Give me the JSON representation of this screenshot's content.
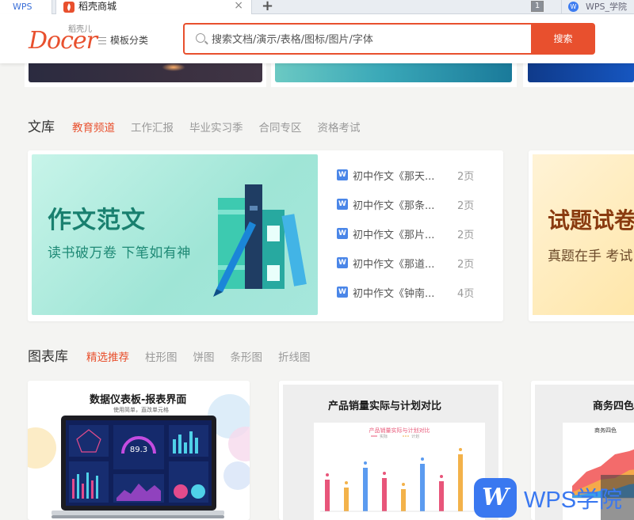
{
  "browser": {
    "tab_wps_label": "WPS",
    "active_tab_title": "稻壳商城",
    "tab_count": "1",
    "other_tab_title": "WPS_学院"
  },
  "header": {
    "logo_text": "Docer",
    "logo_sub": "稻壳儿",
    "category_label": "模板分类",
    "search_placeholder": "搜索文档/演示/表格/图标/图片/字体",
    "search_button": "搜索"
  },
  "library": {
    "title": "文库",
    "tabs": [
      "教育频道",
      "工作汇报",
      "毕业实习季",
      "合同专区",
      "资格考试"
    ],
    "active_tab": 0,
    "hero_title": "作文范文",
    "hero_subtitle": "读书破万卷 下笔如有神",
    "docs": [
      {
        "name": "初中作文《那天...",
        "pages": "2页"
      },
      {
        "name": "初中作文《那条...",
        "pages": "2页"
      },
      {
        "name": "初中作文《那片...",
        "pages": "2页"
      },
      {
        "name": "初中作文《那道...",
        "pages": "2页"
      },
      {
        "name": "初中作文《钟南...",
        "pages": "4页"
      }
    ],
    "exam_title": "试题试卷",
    "exam_subtitle": "真题在手 考试"
  },
  "charts": {
    "title": "图表库",
    "tabs": [
      "精选推荐",
      "柱形图",
      "饼图",
      "条形图",
      "折线图"
    ],
    "active_tab": 0,
    "cards": [
      {
        "title": "数据仪表板-报表界面",
        "subtitle": "使用简单，直改单元格",
        "dashboard_value": "89.3"
      },
      {
        "title": "产品销量实际与计划对比",
        "inner_title": "产品销量实际与计划对比",
        "legend": [
          "实际",
          "计划"
        ]
      },
      {
        "title": "商务四色",
        "inner_title": "商务四色"
      }
    ]
  },
  "watermark": {
    "logo_letter": "W",
    "text": "WPS学院"
  },
  "colors": {
    "accent": "#e8502e",
    "wps_blue": "#3a78f0",
    "hero_green": "#19806f"
  }
}
